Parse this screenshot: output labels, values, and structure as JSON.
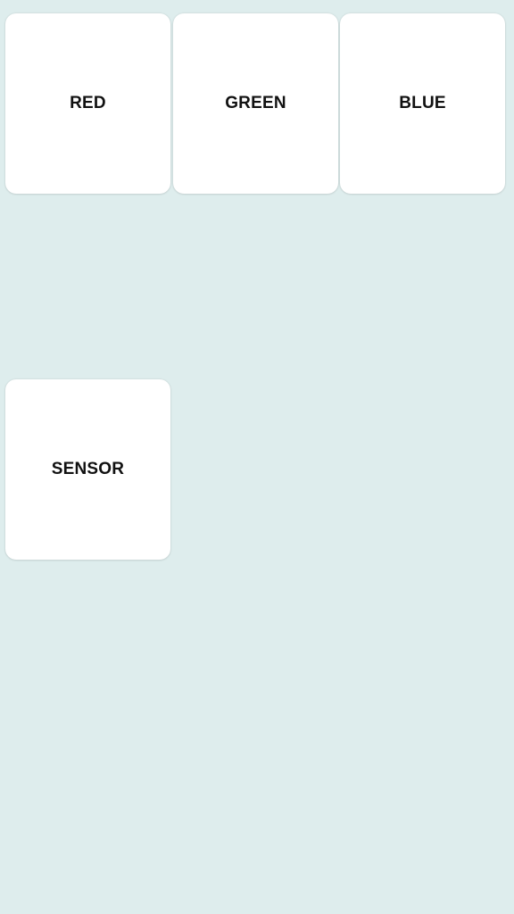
{
  "colors": {
    "background": "#deeded",
    "tile": "#ffffff",
    "label": "#111111"
  },
  "tiles": {
    "red": {
      "label": "RED"
    },
    "green": {
      "label": "GREEN"
    },
    "blue": {
      "label": "BLUE"
    },
    "sensor": {
      "label": "SENSOR"
    }
  }
}
